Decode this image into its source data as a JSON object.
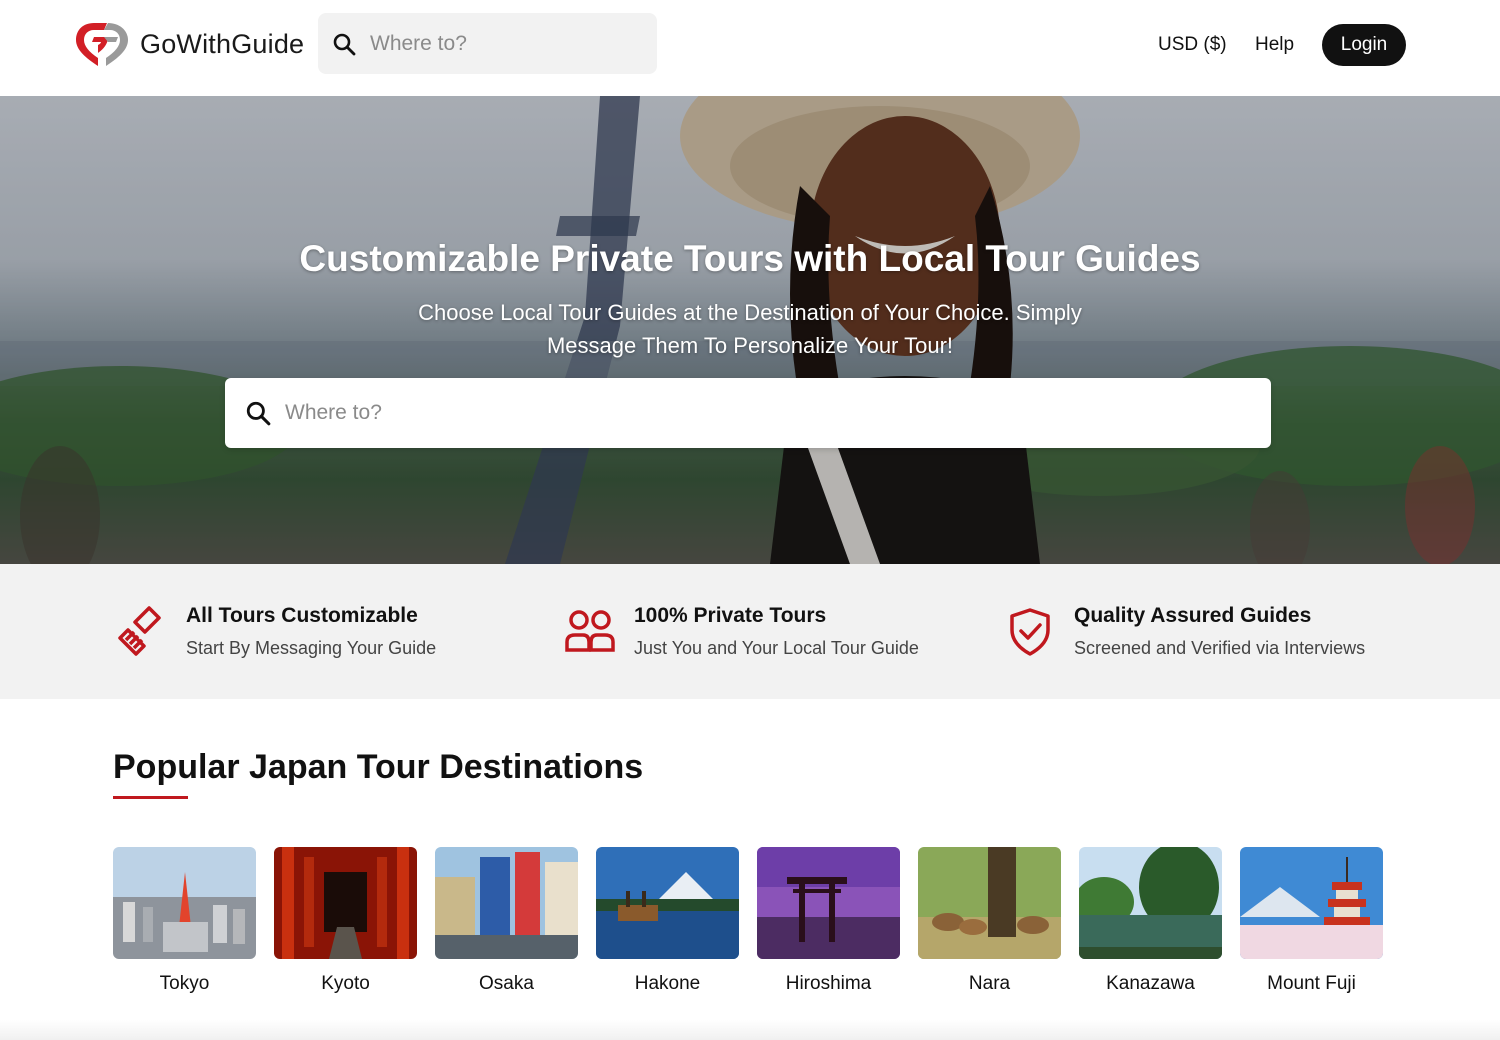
{
  "header": {
    "brand": "GoWithGuide",
    "search_placeholder": "Where to?",
    "currency": "USD ($)",
    "help": "Help",
    "login": "Login"
  },
  "hero": {
    "title": "Customizable Private Tours with Local Tour Guides",
    "subtitle": "Choose Local Tour Guides at the Destination of Your Choice. Simply Message Them To Personalize Your Tour!",
    "search_placeholder": "Where to?"
  },
  "features": [
    {
      "title": "All Tours Customizable",
      "desc": "Start By Messaging Your Guide",
      "icon": "paintbrush-icon"
    },
    {
      "title": "100% Private Tours",
      "desc": "Just You and Your Local Tour Guide",
      "icon": "users-icon"
    },
    {
      "title": "Quality Assured Guides",
      "desc": "Screened and Verified via Interviews",
      "icon": "shield-check-icon"
    }
  ],
  "destinations": {
    "title": "Popular Japan Tour Destinations",
    "items": [
      {
        "name": "Tokyo"
      },
      {
        "name": "Kyoto"
      },
      {
        "name": "Osaka"
      },
      {
        "name": "Hakone"
      },
      {
        "name": "Hiroshima"
      },
      {
        "name": "Nara"
      },
      {
        "name": "Kanazawa"
      },
      {
        "name": "Mount Fuji"
      }
    ]
  },
  "colors": {
    "brand_red": "#c0181e",
    "dark": "#111111",
    "feature_bg": "#f2f2f2"
  }
}
